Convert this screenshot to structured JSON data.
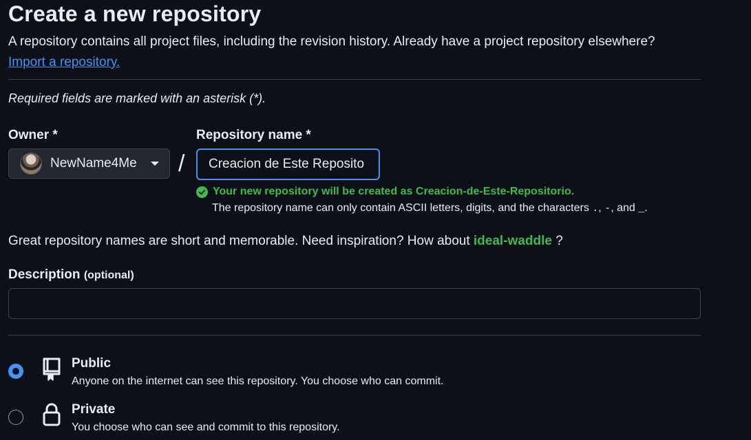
{
  "page": {
    "title": "Create a new repository",
    "subtitle": "A repository contains all project files, including the revision history. Already have a project repository elsewhere?",
    "import_link": "Import a repository.",
    "required_note": "Required fields are marked with an asterisk (*)."
  },
  "owner": {
    "label": "Owner *",
    "value": "NewName4Me"
  },
  "repository": {
    "label": "Repository name *",
    "value": "Creacion de Este Reposito",
    "separator": "/",
    "valid_message": "Your new repository will be created as Creacion-de-Este-Repositorio.",
    "rule_prefix": "The repository name can only contain ASCII letters, digits, and the characters ",
    "rule_char1": ".",
    "rule_sep1": ", ",
    "rule_char2": "-",
    "rule_sep2": ", and ",
    "rule_char3": "_",
    "rule_suffix": "."
  },
  "inspiration": {
    "prefix": "Great repository names are short and memorable. Need inspiration? How about ",
    "suggestion": "ideal-waddle",
    "suffix": " ?"
  },
  "description": {
    "label": "Description",
    "optional": "(optional)",
    "value": ""
  },
  "visibility": {
    "public": {
      "title": "Public",
      "desc": "Anyone on the internet can see this repository. You choose who can commit.",
      "selected": true
    },
    "private": {
      "title": "Private",
      "desc": "You choose who can see and commit to this repository.",
      "selected": false
    }
  },
  "colors": {
    "background": "#0d1117",
    "accent": "#4493f8",
    "success": "#3fb950",
    "border": "#3d444d"
  }
}
